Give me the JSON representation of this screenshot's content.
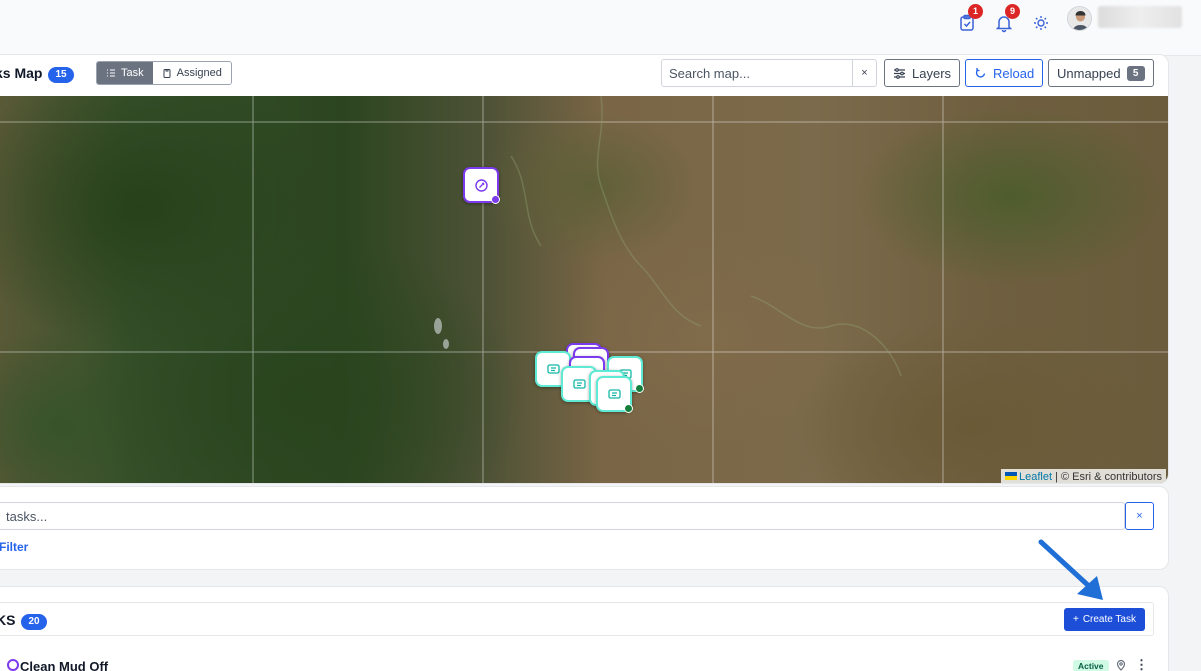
{
  "topbar": {
    "tasks_badge": "1",
    "notifications_badge": "9"
  },
  "map_panel": {
    "title": "ks Map",
    "count": "15",
    "view_toggle": {
      "task_label": "Task",
      "assigned_label": "Assigned",
      "selected": "Task"
    },
    "search": {
      "placeholder": "Search map...",
      "clear_label": "×"
    },
    "layers_label": "Layers",
    "reload_label": "Reload",
    "unmapped_label": "Unmapped",
    "unmapped_count": "5",
    "attribution": {
      "leaflet": "Leaflet",
      "rest": " | © Esri & contributors"
    }
  },
  "task_filter": {
    "search_placeholder": " tasks...",
    "clear_label": "×",
    "filter_label": "Filter"
  },
  "tasks_panel": {
    "title": "KS",
    "count": "20",
    "create_label": "Create Task",
    "create_icon": "+",
    "rows": [
      {
        "name": "Clean Mud Off",
        "status": "Active",
        "more": "⋮"
      }
    ]
  },
  "colors": {
    "accent": "#2563eb",
    "badge": "#dc2626",
    "marker_purple": "#7c3aed",
    "marker_teal": "#14b8a6",
    "marker_green": "#15803d"
  }
}
